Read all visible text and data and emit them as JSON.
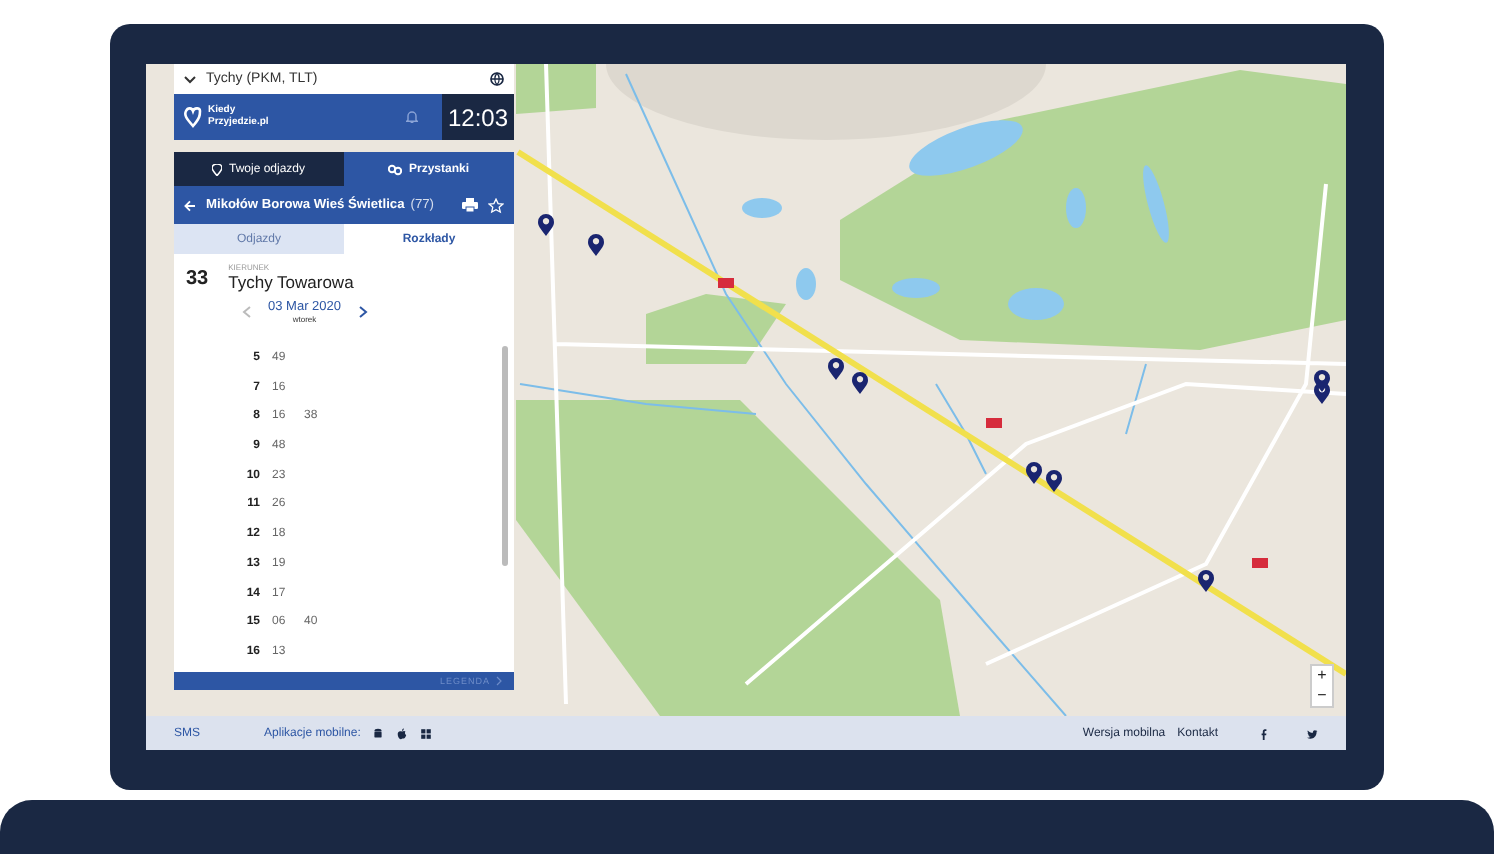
{
  "location": {
    "label": "Tychy (PKM, TLT)"
  },
  "header": {
    "logo_lines": [
      "Kiedy",
      "Przyjedzie.pl"
    ],
    "time": "12:03"
  },
  "tabs": [
    {
      "label": "Twoje odjazdy",
      "selected": false
    },
    {
      "label": "Przystanki",
      "selected": true
    }
  ],
  "stop": {
    "name": "Mikołów Borowa Wieś Świetlica",
    "number": "(77)"
  },
  "subtabs": [
    {
      "label": "Odjazdy",
      "selected": false
    },
    {
      "label": "Rozkłady",
      "selected": true
    }
  ],
  "route": {
    "line": "33",
    "direction_label": "KIERUNEK",
    "direction": "Tychy Towarowa",
    "date": "03 Mar 2020",
    "weekday": "wtorek"
  },
  "timetable": [
    {
      "hour": "5",
      "minutes": [
        "49"
      ]
    },
    {
      "hour": "7",
      "minutes": [
        "16"
      ]
    },
    {
      "hour": "8",
      "minutes": [
        "16",
        "38"
      ]
    },
    {
      "hour": "9",
      "minutes": [
        "48"
      ]
    },
    {
      "hour": "10",
      "minutes": [
        "23"
      ]
    },
    {
      "hour": "11",
      "minutes": [
        "26"
      ]
    },
    {
      "hour": "12",
      "minutes": [
        "18"
      ]
    },
    {
      "hour": "13",
      "minutes": [
        "19"
      ]
    },
    {
      "hour": "14",
      "minutes": [
        "17"
      ]
    },
    {
      "hour": "15",
      "minutes": [
        "06",
        "40"
      ]
    },
    {
      "hour": "16",
      "minutes": [
        "13"
      ]
    }
  ],
  "legend": {
    "label": "LEGENDA"
  },
  "zoom": {
    "in": "+",
    "out": "−"
  },
  "footer": {
    "sms": "SMS",
    "apps_label": "Aplikacje mobilne:",
    "links": [
      "Wersja mobilna",
      "Kontakt"
    ]
  }
}
